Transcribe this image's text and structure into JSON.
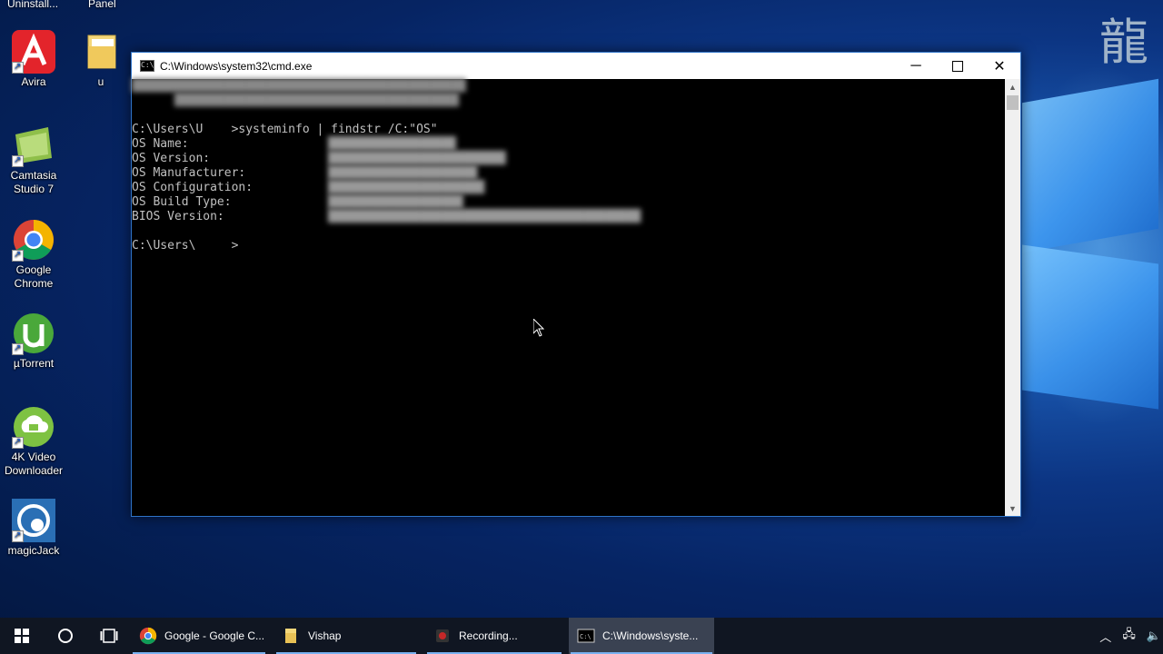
{
  "desktop": {
    "top_labels": [
      "Uninstall...",
      "Panel"
    ],
    "icons": [
      {
        "label": "Avira",
        "icon": "avira-icon"
      },
      {
        "label": "u",
        "icon": "folder-icon"
      },
      {
        "label": "Camtasia Studio 7",
        "icon": "camtasia-icon"
      },
      {
        "label": "Google Chrome",
        "icon": "chrome-icon"
      },
      {
        "label": "µTorrent",
        "icon": "utorrent-icon"
      },
      {
        "label": "4K Video Downloader",
        "icon": "video-downloader-icon"
      },
      {
        "label": "magicJack",
        "icon": "magicjack-icon"
      }
    ]
  },
  "cmd": {
    "title": "C:\\Windows\\system32\\cmd.exe",
    "lines": {
      "command": "C:\\Users\\U    >systeminfo | findstr /C:\"OS\"",
      "os_name": "OS Name:",
      "os_version": "OS Version:",
      "os_manufacturer": "OS Manufacturer:",
      "os_configuration": "OS Configuration:",
      "os_build_type": "OS Build Type:",
      "bios_version": "BIOS Version:",
      "prompt": "C:\\Users\\     >"
    }
  },
  "taskbar": {
    "tasks": [
      {
        "label": "Google - Google C...",
        "icon": "chrome-icon"
      },
      {
        "label": "Vishap",
        "icon": "folder-icon"
      },
      {
        "label": "Recording...",
        "icon": "recording-icon"
      },
      {
        "label": "C:\\Windows\\syste...",
        "icon": "cmd-icon",
        "active": true
      }
    ]
  },
  "colors": {
    "accent": "#2f74c8",
    "taskbar": "#101622",
    "console_text": "#c0c0c0"
  }
}
